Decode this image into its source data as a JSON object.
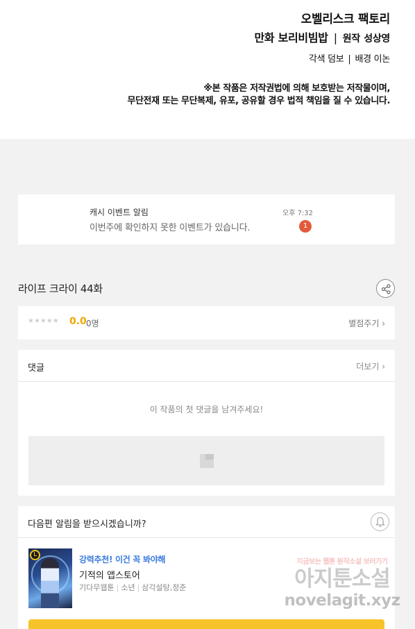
{
  "credits": {
    "studio": "오벨리스크 팩토리",
    "title_credit": "만화 보리비빔밥",
    "original_role": "원작",
    "original_author": "성상영",
    "coloring_role": "각색",
    "coloring_author": "덤보",
    "background_role": "배경",
    "background_author": "이논",
    "separator": "|",
    "notice_line1": "※본 작품은 저작권법에 의해 보호받는 저작물이며,",
    "notice_line2": "무단전재 또는 무단복제, 유포, 공유할 경우 법적 책임을 질 수 있습니다."
  },
  "notification": {
    "title": "캐시 이벤트 알림",
    "message": "이번주에 확인하지 못한 이벤트가 있습니다.",
    "time": "오후 7:32",
    "badge": "1"
  },
  "episode": {
    "title": "라이프 크라이 44화",
    "share_icon": "share-icon"
  },
  "rating": {
    "stars": "★★★★★",
    "score": "0.0",
    "voters": "0명",
    "rate_link": "별점주기 ›"
  },
  "comments": {
    "title": "댓글",
    "more": "더보기 ›",
    "empty_message": "이 작품의 첫 댓글을 남겨주세요!"
  },
  "next_episode": {
    "prompt": "다음편 알림을 받으시겠습니까?",
    "bell_icon": "bell-icon"
  },
  "recommendation": {
    "tag": "강력추천! 이건 꼭 봐야해",
    "title": "기적의 앱스토어",
    "meta": [
      "기다무웹툰",
      "소년",
      "삼각설탕,정준"
    ]
  },
  "watermark": {
    "small": "지금보는 웹툰 원작소설 보러가기",
    "big": "아지툰소설",
    "url": "novelagit.xyz"
  },
  "colors": {
    "accent_yellow": "#f6c42a",
    "score_orange": "#f4a600",
    "badge_red": "#e25b3c",
    "tag_blue": "#3a7be0"
  }
}
